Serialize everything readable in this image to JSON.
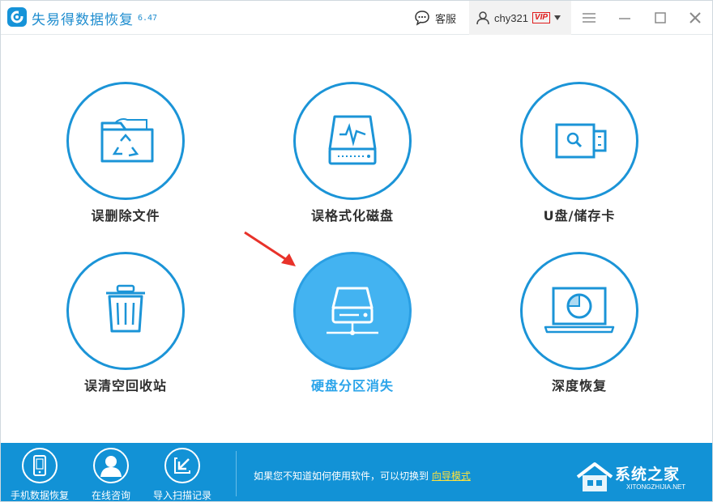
{
  "app": {
    "title": "失易得数据恢复",
    "version": "6.47"
  },
  "header": {
    "support_label": "客服",
    "username": "chy321",
    "vip_badge": "VIP"
  },
  "tiles": [
    {
      "label": "误删除文件",
      "icon": "recycle-folder-icon",
      "active": false
    },
    {
      "label": "误格式化磁盘",
      "icon": "disk-pulse-icon",
      "active": false
    },
    {
      "label": "U盘/储存卡",
      "icon": "usb-drive-icon",
      "active": false
    },
    {
      "label": "误清空回收站",
      "icon": "trash-bin-icon",
      "active": false
    },
    {
      "label": "硬盘分区消失",
      "icon": "hard-drive-network-icon",
      "active": true
    },
    {
      "label": "深度恢复",
      "icon": "laptop-scan-icon",
      "active": false
    }
  ],
  "bottom": {
    "items": [
      {
        "label": "手机数据恢复",
        "icon": "phone-icon"
      },
      {
        "label": "在线咨询",
        "icon": "user-support-icon"
      },
      {
        "label": "导入扫描记录",
        "icon": "import-icon"
      }
    ],
    "hint_text": "如果您不知道如何使用软件，可以切换到",
    "hint_link": "向导模式"
  },
  "watermark": {
    "text": "系统之家",
    "sub": "XITONGZHIJIA.NET"
  },
  "colors": {
    "accent": "#1b94d7",
    "active_fill": "#43b3f1",
    "bottom_bar": "#1292d6",
    "arrow": "#e8322a",
    "link": "#ffe23a"
  }
}
